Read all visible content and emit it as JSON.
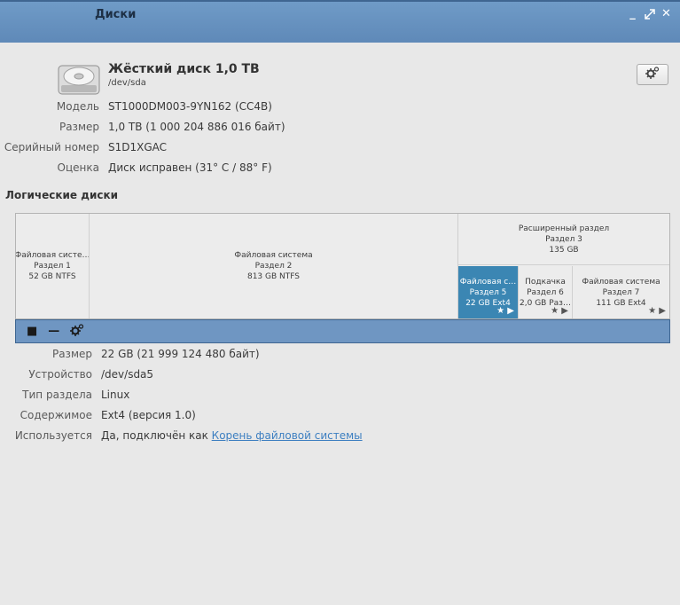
{
  "window": {
    "title": "Диски"
  },
  "disk": {
    "title": "Жёсткий диск 1,0 TB",
    "path": "/dev/sda",
    "info": [
      {
        "label": "Модель",
        "value": "ST1000DM003-9YN162 (CC4B)"
      },
      {
        "label": "Размер",
        "value": "1,0 TB (1 000 204 886 016 байт)"
      },
      {
        "label": "Серийный номер",
        "value": "S1D1XGAC"
      },
      {
        "label": "Оценка",
        "value": "Диск исправен (31° C / 88° F)"
      }
    ]
  },
  "volumes": {
    "section_title": "Логические диски",
    "partitions": [
      {
        "name": "Файловая систе…",
        "part": "Раздел 1",
        "size": "52 GB NTFS"
      },
      {
        "name": "Файловая система",
        "part": "Раздел 2",
        "size": "813 GB NTFS"
      },
      {
        "name": "Расширенный раздел",
        "part": "Раздел 3",
        "size": "135 GB"
      },
      {
        "name": "Файловая с…",
        "part": "Раздел 5",
        "size": "22 GB Ext4",
        "selected": true
      },
      {
        "name": "Подкачка",
        "part": "Раздел 6",
        "size": "2,0 GB Раз…"
      },
      {
        "name": "Файловая система",
        "part": "Раздел 7",
        "size": "111 GB Ext4"
      }
    ],
    "marks": "★ ▶",
    "toolbar": {
      "stop_icon": "■",
      "minus_icon": "—",
      "gear_icon": "gear-icon"
    }
  },
  "details": [
    {
      "label": "Размер",
      "value": "22 GB (21 999 124 480 байт)"
    },
    {
      "label": "Устройство",
      "value": "/dev/sda5"
    },
    {
      "label": "Тип раздела",
      "value": "Linux"
    },
    {
      "label": "Содержимое",
      "value": "Ext4 (версия 1.0)"
    },
    {
      "label": "Используется",
      "value": "Да, подключён как ",
      "link": "Корень файловой системы"
    }
  ]
}
